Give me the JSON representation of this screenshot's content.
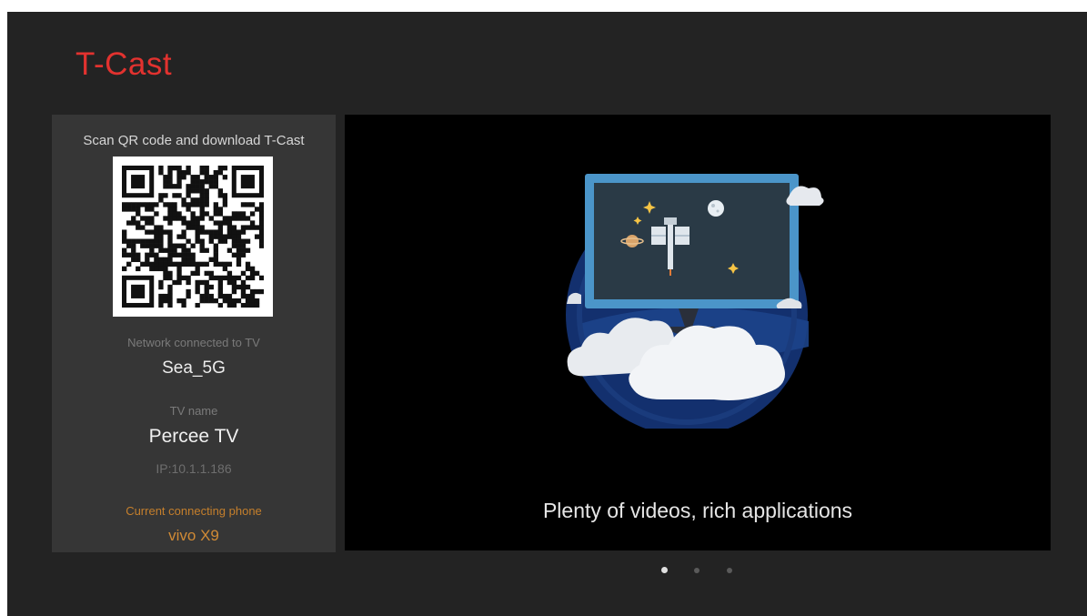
{
  "app": {
    "title": "T-Cast",
    "accent_color": "#e2322f"
  },
  "info_panel": {
    "scan_label": "Scan QR code and download T-Cast",
    "qr_icon": "qr-code-icon",
    "network_caption": "Network connected to TV",
    "network_value": "Sea_5G",
    "tv_name_caption": "TV name",
    "tv_name_value": "Percee TV",
    "ip_text": "IP:10.1.1.186",
    "phone_caption": "Current connecting phone",
    "phone_value": "vivo X9",
    "phone_color": "#d08a35"
  },
  "carousel": {
    "slide_caption": "Plenty of videos, rich applications",
    "illustration_icon": "tv-space-illustration-icon",
    "total_slides": 3,
    "active_slide": 1
  }
}
